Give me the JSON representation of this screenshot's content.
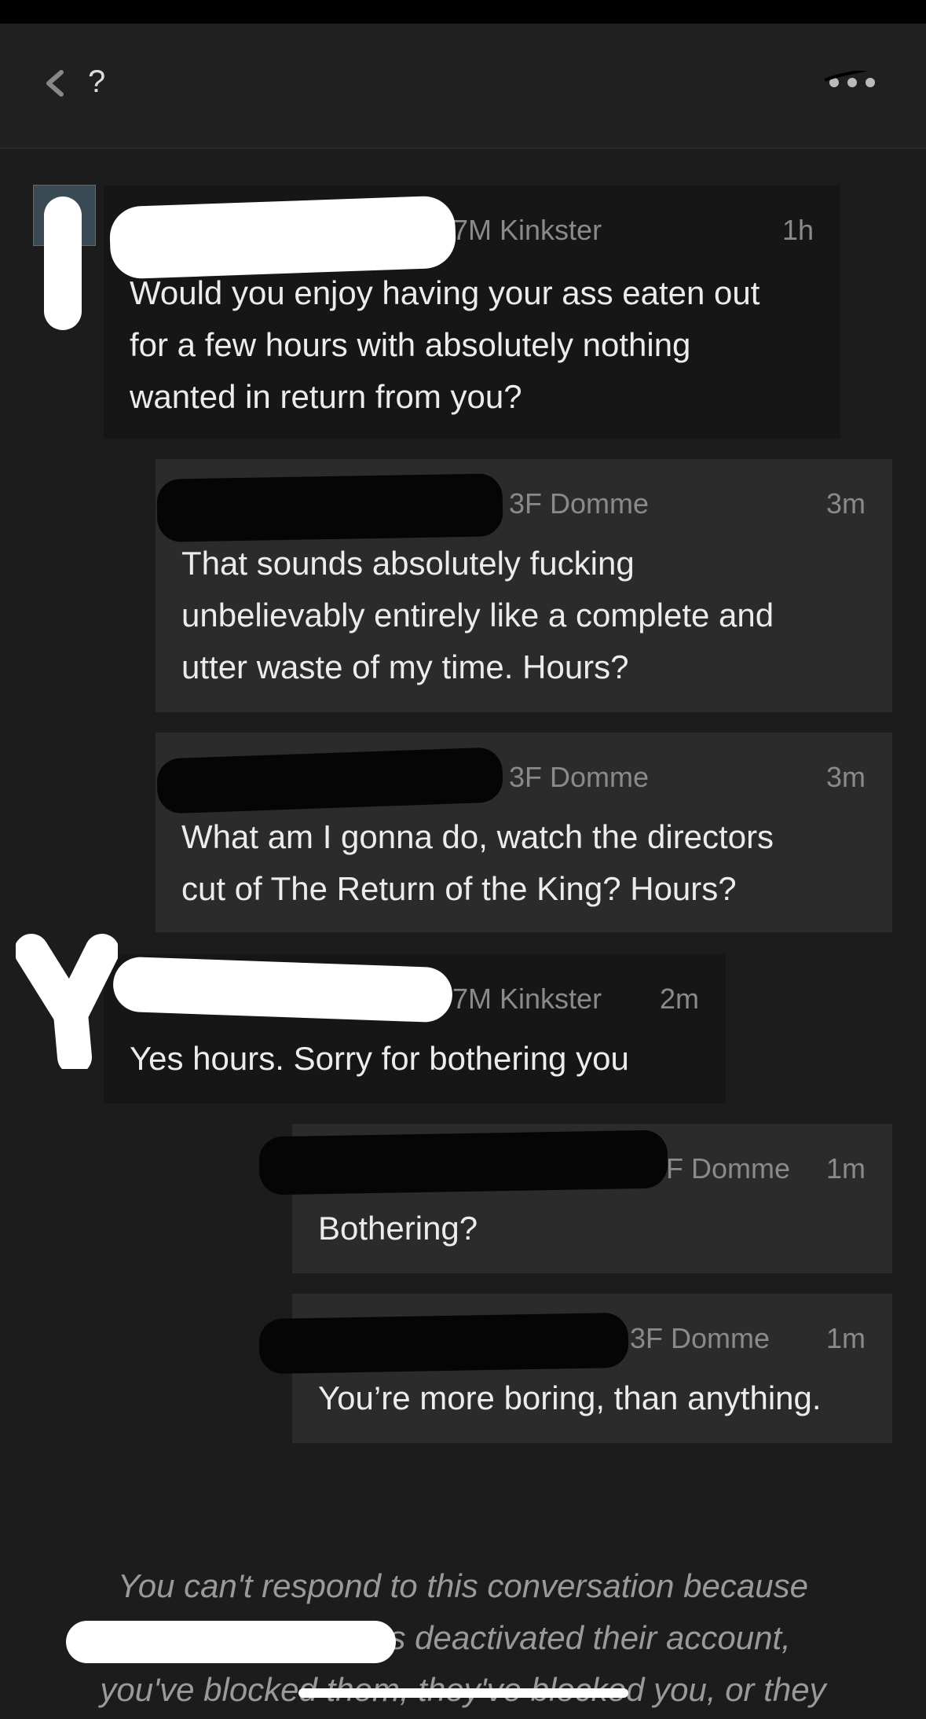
{
  "header": {
    "title": "?"
  },
  "messages": [
    {
      "meta": "7M Kinkster",
      "time": "1h",
      "text": [
        "Would you enjoy having your ass eaten out",
        "for a few hours with absolutely nothing",
        "wanted in return from you?"
      ]
    },
    {
      "meta": "3F Domme",
      "time": "3m",
      "text": [
        "That sounds absolutely fucking",
        "unbelievably entirely like a complete and",
        "utter waste of my time. Hours?"
      ]
    },
    {
      "meta": "3F Domme",
      "time": "3m",
      "text": [
        "What am I gonna do, watch the directors",
        "cut of The Return of the King? Hours?"
      ]
    },
    {
      "meta": "7M Kinkster",
      "time": "2m",
      "text": [
        "Yes hours. Sorry for bothering you"
      ]
    },
    {
      "meta": "F Domme",
      "time": "1m",
      "text": [
        "Bothering?"
      ]
    },
    {
      "meta": "3F Domme",
      "time": "1m",
      "text": [
        "You’re more boring, than anything."
      ]
    }
  ],
  "footer": {
    "lines": [
      "You can't respond to this conversation because",
      "as deactivated their account,",
      "you've blocked them, they've blocked you, or they"
    ]
  }
}
